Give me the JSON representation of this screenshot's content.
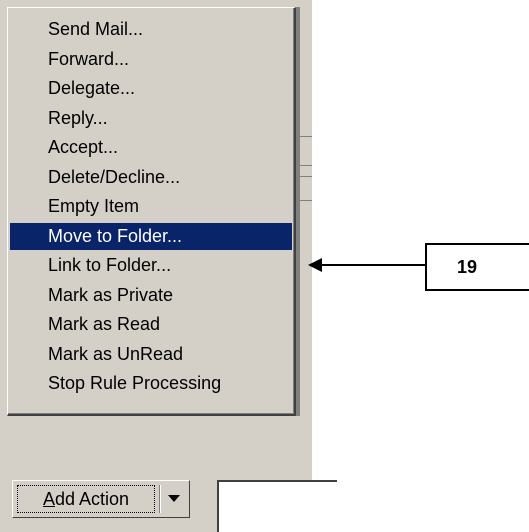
{
  "menu": {
    "items": [
      {
        "label": "Send Mail..."
      },
      {
        "label": "Forward..."
      },
      {
        "label": "Delegate..."
      },
      {
        "label": "Reply..."
      },
      {
        "label": "Accept..."
      },
      {
        "label": "Delete/Decline..."
      },
      {
        "label": "Empty Item"
      },
      {
        "label": "Move to Folder..."
      },
      {
        "label": "Link to Folder..."
      },
      {
        "label": "Mark as Private"
      },
      {
        "label": "Mark as Read"
      },
      {
        "label": "Mark as UnRead"
      },
      {
        "label": "Stop Rule Processing"
      }
    ],
    "selected_index": 7
  },
  "add_action": {
    "label": "Add Action"
  },
  "callout": {
    "number": "19"
  },
  "colors": {
    "selection": "#0a246a",
    "face": "#d4d0c8"
  }
}
